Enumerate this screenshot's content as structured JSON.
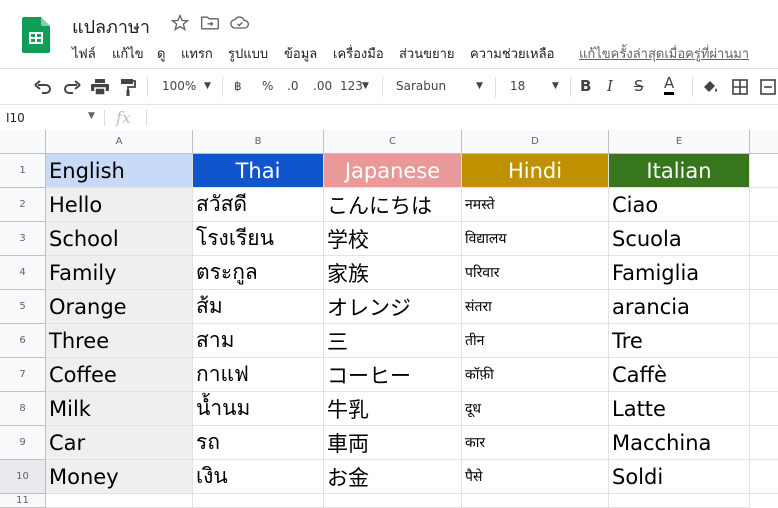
{
  "doc": {
    "title": "แปลภาษา",
    "last_edit": "แก้ไขครั้งล่าสุดเมื่อครู่ที่ผ่านมา"
  },
  "menu": [
    "ไฟล์",
    "แก้ไข",
    "ดู",
    "แทรก",
    "รูปแบบ",
    "ข้อมูล",
    "เครื่องมือ",
    "ส่วนขยาย",
    "ความช่วยเหลือ"
  ],
  "toolbar": {
    "zoom": "100%",
    "currency": "฿",
    "percent": "%",
    "dec_decrease": ".0",
    "dec_increase": ".00",
    "format_more": "123",
    "font": "Sarabun",
    "font_size": "18",
    "bold": "B",
    "italic": "I",
    "strike": "S",
    "text_color": "A"
  },
  "formula_bar": {
    "cell_ref": "I10",
    "fx": "fx"
  },
  "columns": [
    "A",
    "B",
    "C",
    "D",
    "E"
  ],
  "rows": [
    "1",
    "2",
    "3",
    "4",
    "5",
    "6",
    "7",
    "8",
    "9",
    "10",
    "11"
  ],
  "header_row": [
    "English",
    "Thai",
    "Japanese",
    "Hindi",
    "Italian"
  ],
  "header_colors": [
    "#c9daf8",
    "#1155cc",
    "#ea9999",
    "#bf9000",
    "#38761d"
  ],
  "data_rows": [
    [
      "Hello",
      "สวัสดี",
      "こんにちは",
      "नमस्ते",
      "Ciao"
    ],
    [
      "School",
      "โรงเรียน",
      "学校",
      "विद्यालय",
      "Scuola"
    ],
    [
      "Family",
      "ตระกูล",
      "家族",
      "परिवार",
      "Famiglia"
    ],
    [
      "Orange",
      "ส้ม",
      "オレンジ",
      "संतरा",
      "arancia"
    ],
    [
      "Three",
      "สาม",
      "三",
      "तीन",
      "Tre"
    ],
    [
      "Coffee",
      "กาแฟ",
      "コーヒー",
      "कॉफ़ी",
      "Caffè"
    ],
    [
      "Milk",
      "น้ำนม",
      "牛乳",
      "दूध",
      "Latte"
    ],
    [
      "Car",
      "รถ",
      "車両",
      "कार",
      "Macchina"
    ],
    [
      "Money",
      "เงิน",
      "お金",
      "पैसे",
      "Soldi"
    ]
  ]
}
